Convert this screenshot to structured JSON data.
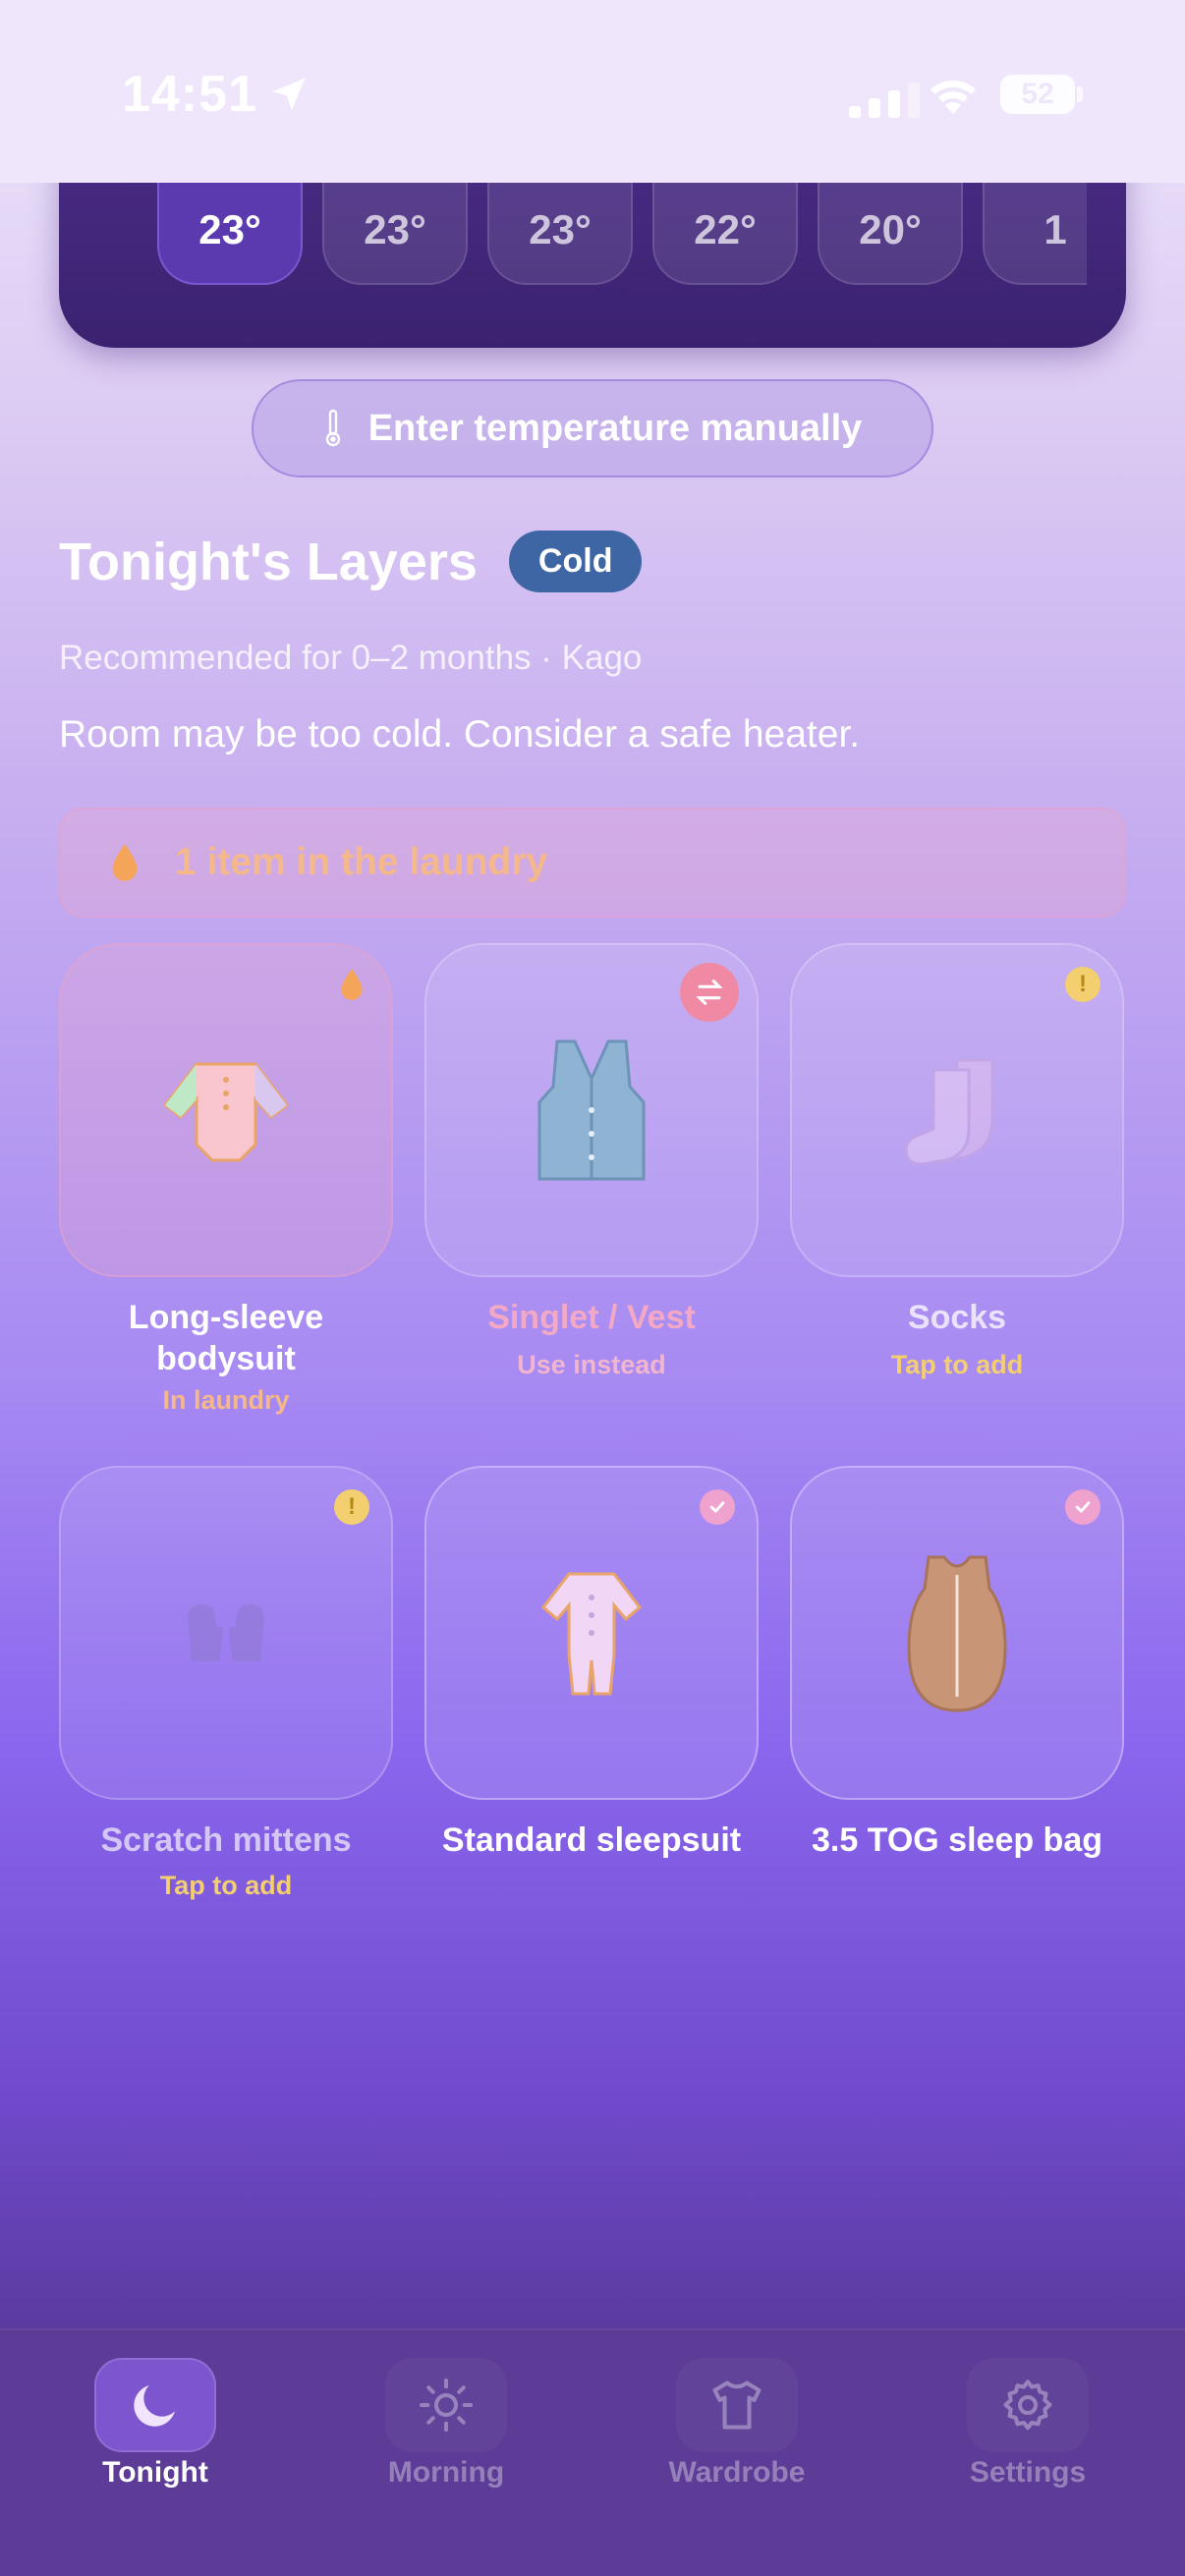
{
  "status_bar": {
    "time": "14:51",
    "battery": "52"
  },
  "forecast": {
    "hours": [
      "23°",
      "23°",
      "23°",
      "22°",
      "20°",
      "1"
    ]
  },
  "manual_button": {
    "label": "Enter temperature manually"
  },
  "layers": {
    "title": "Tonight's Layers",
    "badge": "Cold",
    "recommendation": "Recommended for 0–2 months · Kago",
    "warning": "Room may be too cold. Consider a safe heater."
  },
  "laundry_banner": {
    "text": "1 item in the laundry"
  },
  "items": [
    {
      "name": "Long-sleeve bodysuit",
      "status": "In laundry"
    },
    {
      "name": "Singlet / Vest",
      "status": "Use instead"
    },
    {
      "name": "Socks",
      "status": "Tap to add"
    },
    {
      "name": "Scratch mittens",
      "status": "Tap to add"
    },
    {
      "name": "Standard sleepsuit",
      "status": ""
    },
    {
      "name": "3.5 TOG sleep bag",
      "status": ""
    }
  ],
  "tabs": [
    {
      "label": "Tonight",
      "icon": "moon-icon"
    },
    {
      "label": "Morning",
      "icon": "sun-icon"
    },
    {
      "label": "Wardrobe",
      "icon": "shirt-icon"
    },
    {
      "label": "Settings",
      "icon": "gear-icon"
    }
  ],
  "colors": {
    "accent": "#7d55cf",
    "cold_badge": "#3f66a4",
    "laundry": "#f5b88a",
    "warning_dot": "#f3cf6f",
    "check_dot": "#f0a2cf"
  }
}
